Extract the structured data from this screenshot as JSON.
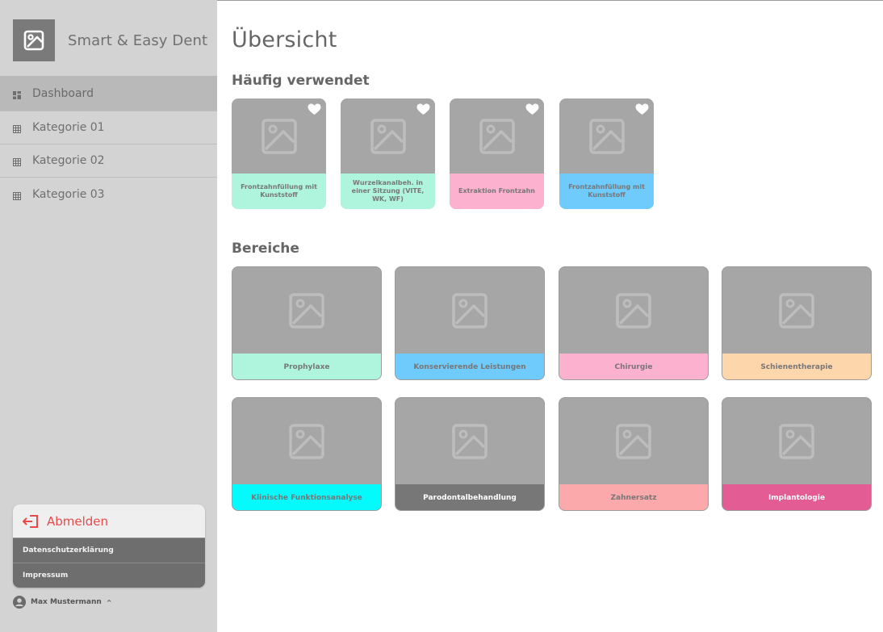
{
  "app": {
    "name": "Smart & Easy Dent"
  },
  "sidebar": {
    "items": [
      {
        "label": "Dashboard",
        "icon": "dashboard-icon",
        "active": true
      },
      {
        "label": "Kategorie 01",
        "icon": "table-icon",
        "active": false
      },
      {
        "label": "Kategorie 02",
        "icon": "table-icon",
        "active": false
      },
      {
        "label": "Kategorie 03",
        "icon": "table-icon",
        "active": false
      }
    ],
    "logout_label": "Abmelden",
    "privacy_label": "Datenschutzerklärung",
    "imprint_label": "Impressum",
    "user_name": "Max Mustermann"
  },
  "main": {
    "title": "Übersicht",
    "favorites_title": "Häufig verwendet",
    "areas_title": "Bereiche",
    "favorites": [
      {
        "label": "Frontzahnfüllung mit Kunststoff",
        "color": "#aff5dd",
        "favorite": true
      },
      {
        "label": "Wurzelkanalbeh. in einer Sitzung (VITE, WK, WF)",
        "color": "#aff5dd",
        "favorite": true
      },
      {
        "label": "Extraktion Frontzahn",
        "color": "#fcb1cf",
        "favorite": true
      },
      {
        "label": "Frontzahnfüllung mit Kunststoff",
        "color": "#6ecbfb",
        "favorite": true
      }
    ],
    "areas": [
      {
        "label": "Prophylaxe",
        "color": "#aff5dd"
      },
      {
        "label": "Konservierende Leistungen",
        "color": "#6ecbfb"
      },
      {
        "label": "Chirurgie",
        "color": "#fcb1cf"
      },
      {
        "label": "Schienentherapie",
        "color": "#fdd6ac"
      },
      {
        "label": "Klinische Funktionsanalyse",
        "color": "#05fbfb"
      },
      {
        "label": "Parodontalbehandlung",
        "color": "#777777"
      },
      {
        "label": "Zahnersatz",
        "color": "#fca9ac"
      },
      {
        "label": "Implantologie",
        "color": "#e35c93"
      }
    ]
  }
}
